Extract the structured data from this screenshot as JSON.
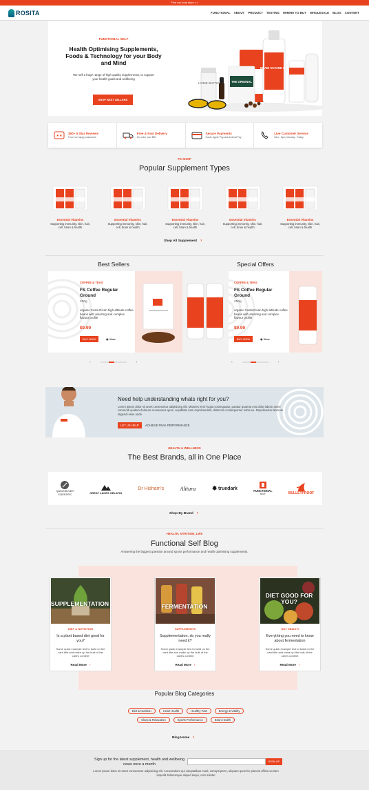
{
  "topbar": {
    "text": "Find my local store >>"
  },
  "logo": {
    "text": "ROSITA"
  },
  "nav": [
    "FUNCTIONAL",
    "ABOUT",
    "PRODUCT",
    "TESTING",
    "WHERE TO BUY",
    "WHOLESALE",
    "BLOG",
    "CONTENT"
  ],
  "hero": {
    "kicker": "Functional Self",
    "title": "Health Optimising Supplements, Foods & Technology for your Body and Mind",
    "text": "We sell a huge range of high quality supplements, to support your health goals and wellbeing",
    "button": "Shop Best Sellers",
    "bottle_label": "BRAIN OCTANE OIL",
    "bag_label": "THE ORIGINAL",
    "jar_label": "HOME BIOTIX"
  },
  "features": [
    {
      "title": "350+ 5 Star Reviews",
      "sub": "From our happy customers",
      "icon": "star-icon"
    },
    {
      "title": "Free & Fast Delivery",
      "sub": "On order over $50",
      "icon": "truck-icon"
    },
    {
      "title": "Secure Payments",
      "sub": "Cards, Apple Pay and Android Pay",
      "icon": "card-icon"
    },
    {
      "title": "Live Customer Service",
      "sub": "9am - 5pm, Monday - Friday",
      "icon": "phone-icon"
    }
  ],
  "types": {
    "kicker": "FS Shop",
    "title": "Popular Supplement Types",
    "items": [
      {
        "title": "Essential Vitamins",
        "desc": "Supporting immunity, skin, hair, cell, brain & health"
      },
      {
        "title": "Essential Vitamins",
        "desc": "Supporting immunity, skin, hair, cell, brain & health"
      },
      {
        "title": "Essential Vitamins",
        "desc": "Supporting immunity, skin, hair, cell, brain & health"
      },
      {
        "title": "Essential Vitamins",
        "desc": "Supporting immunity, skin, hair, cell, brain & health"
      },
      {
        "title": "Essential Vitamins",
        "desc": "Supporting immunity, skin, hair, cell, brain & health"
      }
    ],
    "cta": "Shop All Supplement"
  },
  "best_sellers": {
    "title": "Best Sellers",
    "tag": "Coffee & Teas",
    "name": "FS Coffee Regular Ground",
    "weight": "250g",
    "desc": "organic Costa Rican high-altitude coffee beans with amazing and complex flavour profile",
    "price": "$9.99",
    "buy": "Buy Now",
    "view": "View"
  },
  "special_offers": {
    "title": "Special Offers",
    "tag": "Coffee & Teas",
    "name": "FS Coffee Regular Ground",
    "weight": "250g",
    "desc": "organic Costa Rican high-altitude coffee beans with amazing and complex flavour profile",
    "price": "$9.99",
    "buy": "Buy Now",
    "view": "View"
  },
  "slider": {
    "prev": "‹",
    "next": "›"
  },
  "help": {
    "title": "Need help understanding whats right for you?",
    "text": "Lorem ipsum dolor sit amet consectetur adipisicing elit. Maiores error fugiat consequatur, paratur quaerat eos dolor labore animi commodi quidem dolorum accusamus quos, cupiditate nam reprehenderit, distinctio consequuntur nobis ex. Repellendus laborum eligendi esse unde.",
    "button": "Let us help",
    "link": "Achieve Peak Performance"
  },
  "brands": {
    "kicker": "Health & Wellness",
    "title": "The Best Brands, all in One Place",
    "items": [
      {
        "name": "Quicksilver Scientific",
        "line1": "QUICKSILVER",
        "line2": "SCIENTIFIC"
      },
      {
        "name": "Great Lakes Gelatin",
        "line1": "GREAT LAKES GELATIN",
        "line2": ""
      },
      {
        "name": "Dr Hisham's",
        "line1": "Dr Hisham's",
        "line2": ""
      },
      {
        "name": "Alitura",
        "line1": "Alitura",
        "line2": ""
      },
      {
        "name": "truedark",
        "line1": "truedark",
        "line2": ""
      },
      {
        "name": "Functional Self",
        "line1": "FUNCTIONAL",
        "line2": "SELF"
      },
      {
        "name": "Bulletproof",
        "line1": "BULLETPROOF",
        "line2": ""
      }
    ],
    "cta": "Shop By Brand"
  },
  "blog": {
    "kicker": "Health, Ntrition, Life",
    "title": "Functional Self Blog",
    "subtitle": "Answering the biggest question around sports performance and health optimising supplements.",
    "posts": [
      {
        "overlay": "SUPPLEMENTATION",
        "category": "Diet & Nutrition",
        "title": "Is a plant based diet good for you?",
        "text": "Some quick example text to build on the card title and make up the bulk of the card's content",
        "more": "Read More"
      },
      {
        "overlay": "FERMENTATION",
        "category": "Supplements",
        "title": "Supplementation, do you really need it?",
        "text": "Some quick example text to build on the card title and make up the bulk of the card's content",
        "more": "Read More"
      },
      {
        "overlay": "DIET GOOD FOR YOU?",
        "category": "Gut Health",
        "title": "Everything you need to know about fermentation",
        "text": "Some quick example text to build on the card title and make up the bulk of the card's content",
        "more": "Read More"
      }
    ],
    "categories_title": "Popular Blog Categories",
    "categories": [
      "Diet & Nutrition",
      "Heart Health",
      "Healthy Fats",
      "Energy & Vitality",
      "Sleep & Relaxation",
      "Sports Performance",
      "Brain Health"
    ],
    "cta": "Blog Home"
  },
  "newsletter": {
    "title": "Sign up for the latest supplement, health and wellbeing news once a month",
    "button": "Sign up",
    "text": "Lorem ipsum dolor sit amet consectetur adipisicing elit. Accusantium qui voluptatibus modi, corrupti porro, aliquam quos hic placeat officia veniam impedit doloremque aliquid sequi, cum soluta!"
  },
  "colors": {
    "accent": "#e8421f",
    "pink": "#fbe3dd",
    "navy": "#0a4466"
  }
}
